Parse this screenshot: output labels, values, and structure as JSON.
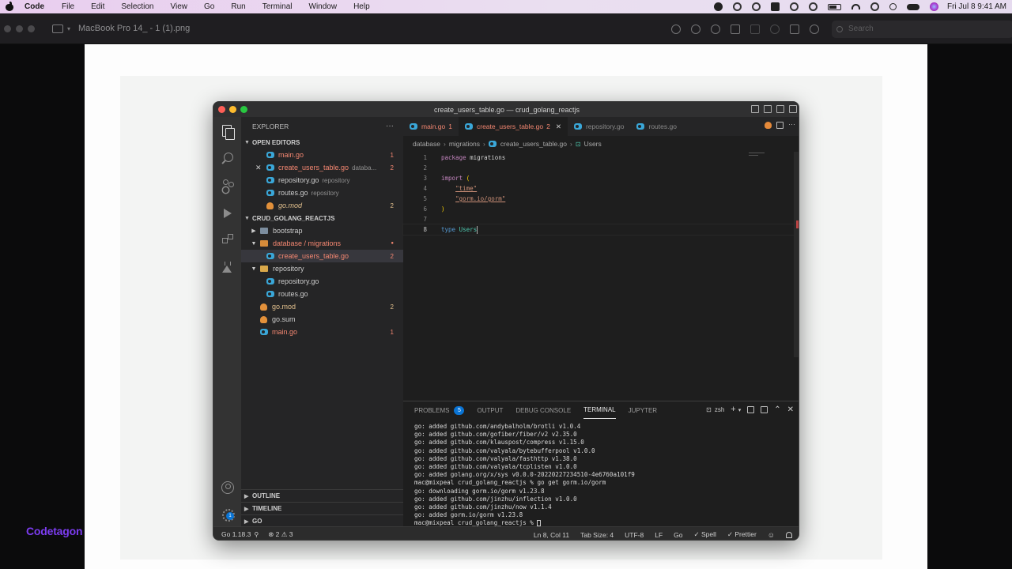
{
  "menubar": {
    "app": "Code",
    "items": [
      "File",
      "Edit",
      "Selection",
      "View",
      "Go",
      "Run",
      "Terminal",
      "Window",
      "Help"
    ],
    "clock": "Fri Jul 8  9:41 AM"
  },
  "preview": {
    "title": "MacBook Pro 14_ - 1 (1).png",
    "search_placeholder": "Search"
  },
  "watermark": "Codetagon",
  "vscode": {
    "window_title": "create_users_table.go — crud_golang_reactjs",
    "explorer_title": "EXPLORER",
    "explorer_more": "···",
    "open_editors_title": "OPEN EDITORS",
    "open_editors": [
      {
        "name": "main.go",
        "desc": "",
        "count": "1",
        "color": "#f48771"
      },
      {
        "name": "create_users_table.go",
        "desc": "databa...",
        "count": "2",
        "color": "#f48771"
      },
      {
        "name": "repository.go",
        "desc": "repository",
        "count": "",
        "color": "#cccccc"
      },
      {
        "name": "routes.go",
        "desc": "repository",
        "count": "",
        "color": "#cccccc"
      },
      {
        "name": "go.mod",
        "desc": "",
        "count": "2",
        "color": "#e2c08d"
      }
    ],
    "project_title": "CRUD_GOLANG_REACTJS",
    "tree": {
      "bootstrap": "bootstrap",
      "db_folder": "database / migrations",
      "db_dot": "●",
      "create_file": "create_users_table.go",
      "create_count": "2",
      "repo_folder": "repository",
      "repo_file": "repository.go",
      "routes_file": "routes.go",
      "gomod": "go.mod",
      "gomod_count": "2",
      "gosum": "go.sum",
      "maingo": "main.go",
      "maingo_count": "1"
    },
    "bottom_sections": [
      "OUTLINE",
      "TIMELINE",
      "GO"
    ],
    "tabs": [
      {
        "name": "main.go",
        "num": "1",
        "active": false,
        "color": "#f48771"
      },
      {
        "name": "create_users_table.go",
        "num": "2",
        "active": true,
        "color": "#f48771"
      },
      {
        "name": "repository.go",
        "num": "",
        "active": false,
        "color": "#8a8a8a"
      },
      {
        "name": "routes.go",
        "num": "",
        "active": false,
        "color": "#8a8a8a"
      }
    ],
    "tab_close": "✕",
    "breadcrumb": [
      "database",
      "migrations",
      "create_users_table.go",
      "Users"
    ],
    "code": {
      "l1_kw": "package",
      "l1_rest": " migrations",
      "l3_kw": "import",
      "l3_paren": "(",
      "l4_str": "\"time\"",
      "l5_str": "\"gorm.io/gorm\"",
      "l6_paren": ")",
      "l8_kw": "type",
      "l8_ident": "Users"
    },
    "line_numbers": [
      "1",
      "2",
      "3",
      "4",
      "5",
      "6",
      "7",
      "8"
    ],
    "panel_tabs": [
      "PROBLEMS",
      "OUTPUT",
      "DEBUG CONSOLE",
      "TERMINAL",
      "JUPYTER"
    ],
    "problems_count": "5",
    "active_panel_tab": "TERMINAL",
    "shell": "zsh",
    "terminal_lines": [
      "go: added github.com/andybalholm/brotli v1.0.4",
      "go: added github.com/gofiber/fiber/v2 v2.35.0",
      "go: added github.com/klauspost/compress v1.15.0",
      "go: added github.com/valyala/bytebufferpool v1.0.0",
      "go: added github.com/valyala/fasthttp v1.38.0",
      "go: added github.com/valyala/tcplisten v1.0.0",
      "go: added golang.org/x/sys v0.0.0-20220227234510-4e6760a101f9",
      "mac@mixpeal crud_golang_reactjs % go get gorm.io/gorm",
      "go: downloading gorm.io/gorm v1.23.8",
      "go: added github.com/jinzhu/inflection v1.0.0",
      "go: added github.com/jinzhu/now v1.1.4",
      "go: added gorm.io/gorm v1.23.8"
    ],
    "prompt": "mac@mixpeal crud_golang_reactjs % ",
    "status": {
      "go_version": "Go 1.18.3",
      "errors": "⊗ 2 ⚠ 3",
      "position": "Ln 8, Col 11",
      "tab_size": "Tab Size: 4",
      "encoding": "UTF-8",
      "eol": "LF",
      "language": "Go",
      "spell": "✓ Spell",
      "prettier": "✓ Prettier"
    },
    "activity_badge": "1"
  }
}
